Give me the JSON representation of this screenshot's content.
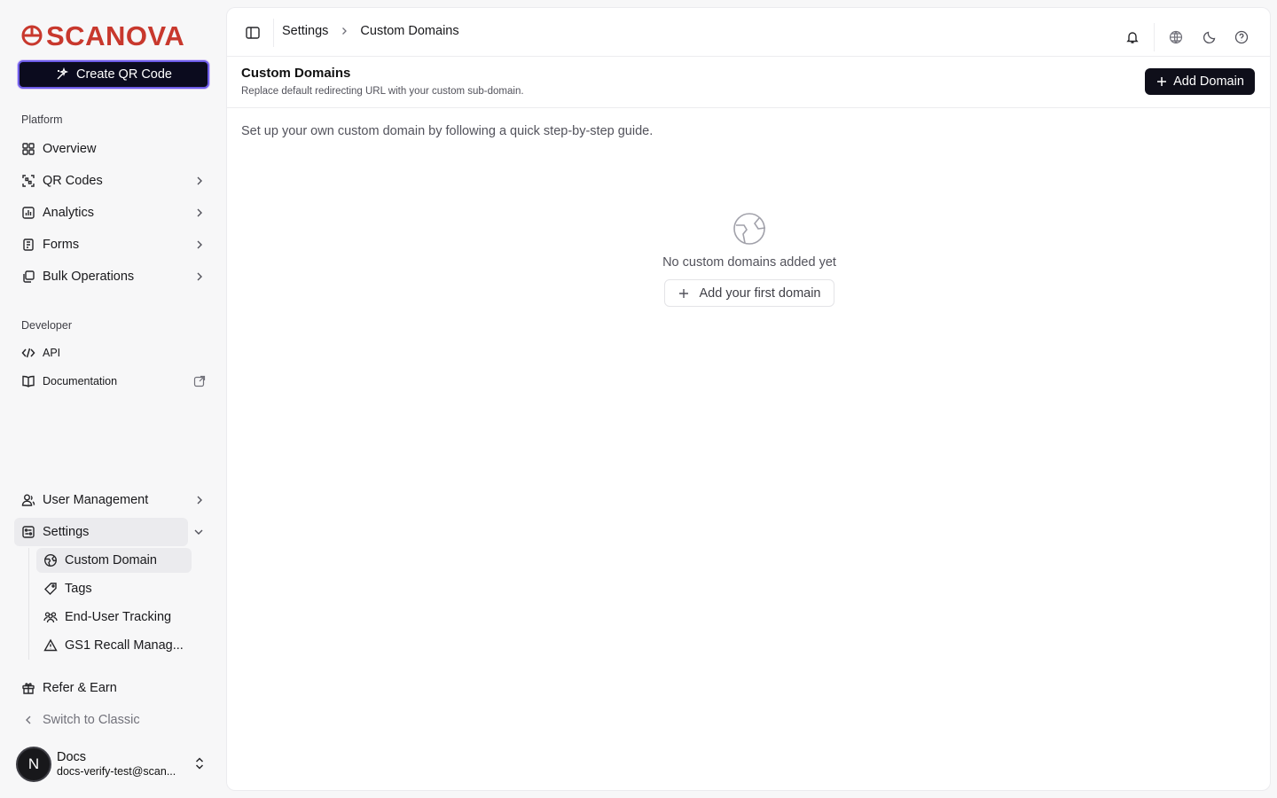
{
  "brand": {
    "name": "SCANOVA",
    "color": "#c8382d"
  },
  "sidebar": {
    "create_button": "Create QR Code",
    "platform_label": "Platform",
    "platform_items": [
      {
        "label": "Overview",
        "icon": "grid-icon",
        "has_chevron": false
      },
      {
        "label": "QR Codes",
        "icon": "qr-scan-icon",
        "has_chevron": true
      },
      {
        "label": "Analytics",
        "icon": "chart-icon",
        "has_chevron": true
      },
      {
        "label": "Forms",
        "icon": "form-icon",
        "has_chevron": true
      },
      {
        "label": "Bulk Operations",
        "icon": "layers-icon",
        "has_chevron": true
      }
    ],
    "developer_label": "Developer",
    "developer_items": [
      {
        "label": "API",
        "icon": "code-icon"
      },
      {
        "label": "Documentation",
        "icon": "book-icon"
      }
    ],
    "user_management": "User Management",
    "settings": "Settings",
    "settings_children": [
      {
        "label": "Custom Domain",
        "icon": "globe-icon",
        "active": true
      },
      {
        "label": "Tags",
        "icon": "tag-icon",
        "active": false
      },
      {
        "label": "End-User Tracking",
        "icon": "users-icon",
        "active": false
      },
      {
        "label": "GS1 Recall Manag...",
        "icon": "warning-icon",
        "active": false
      }
    ],
    "refer": "Refer & Earn",
    "switch_classic": "Switch to Classic",
    "user": {
      "initial": "N",
      "name": "Docs",
      "email": "docs-verify-test@scan..."
    }
  },
  "topbar": {
    "breadcrumb": [
      "Settings",
      "Custom Domains"
    ]
  },
  "page": {
    "title": "Custom Domains",
    "subtitle": "Replace default redirecting URL with your custom sub-domain.",
    "add_button": "Add Domain",
    "intro": "Set up your own custom domain by following a quick step-by-step guide.",
    "empty_text": "No custom domains added yet",
    "empty_button": "Add your first domain"
  }
}
